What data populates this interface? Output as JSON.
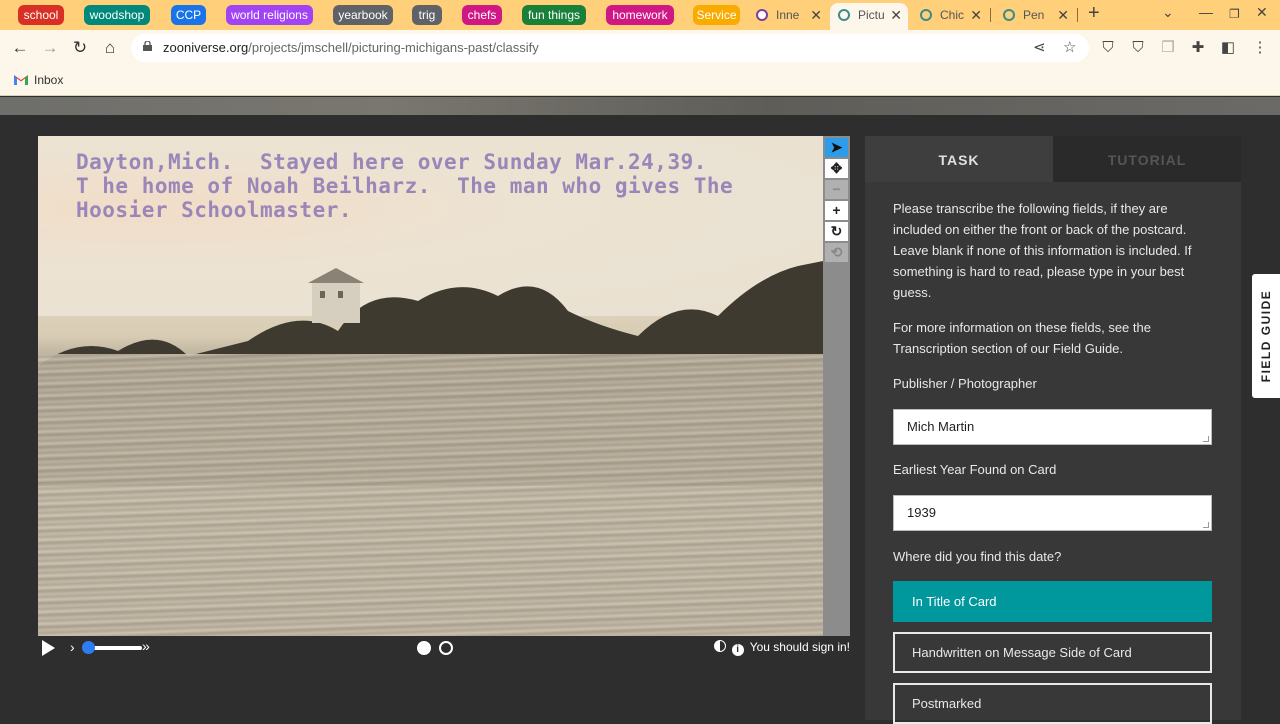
{
  "browser": {
    "tab_groups": [
      {
        "label": "school",
        "color": "#d93025"
      },
      {
        "label": "woodshop",
        "color": "#00897b"
      },
      {
        "label": "CCP",
        "color": "#1a73e8"
      },
      {
        "label": "world religions",
        "color": "#a142f4"
      },
      {
        "label": "yearbook",
        "color": "#5f6368"
      },
      {
        "label": "trig",
        "color": "#5f6368"
      },
      {
        "label": "chefs",
        "color": "#d01884"
      },
      {
        "label": "fun things",
        "color": "#188038"
      },
      {
        "label": "homework",
        "color": "#d01884"
      },
      {
        "label": "Service",
        "color": "#f9ab00"
      }
    ],
    "tabs": [
      {
        "title": "Inne",
        "close": "✕"
      },
      {
        "title": "Pictu",
        "close": "✕"
      },
      {
        "title": "Chic",
        "close": "✕"
      },
      {
        "title": "Pen",
        "close": "✕"
      }
    ],
    "new_tab": "+",
    "url_domain": "zooniverse.org",
    "url_path": "/projects/jmschell/picturing-michigans-past/classify",
    "bookmark": "Inbox"
  },
  "subject": {
    "caption_line1": "Dayton,Mich.  Stayed here over Sunday Mar.24,39.",
    "caption_line2": "T he home of Noah Beilharz.  The man who gives The",
    "caption_line3": "Hoosier Schoolmaster."
  },
  "player": {
    "signin_text": "You should sign in!"
  },
  "panel": {
    "tabs": {
      "task": "TASK",
      "tutorial": "TUTORIAL"
    },
    "instructions_1": "Please transcribe the following fields, if they are included on either the front or back of the postcard. Leave blank if none of this information is included. If something is hard to read, please type in your best guess.",
    "instructions_2": "For more information on these fields, see the Transcription section of our Field Guide.",
    "publisher_label": "Publisher / Photographer",
    "publisher_value": "Mich Martin",
    "year_label": "Earliest Year Found on Card",
    "year_value": "1939",
    "date_question": "Where did you find this date?",
    "choices": [
      {
        "label": "In Title of Card",
        "selected": true
      },
      {
        "label": "Handwritten on Message Side of Card",
        "selected": false
      },
      {
        "label": "Postmarked",
        "selected": false
      }
    ]
  },
  "field_guide": "FIELD GUIDE",
  "colors": {
    "accent": "#00979d",
    "tab_strip": "#ffcf7a",
    "panel": "#383838"
  }
}
